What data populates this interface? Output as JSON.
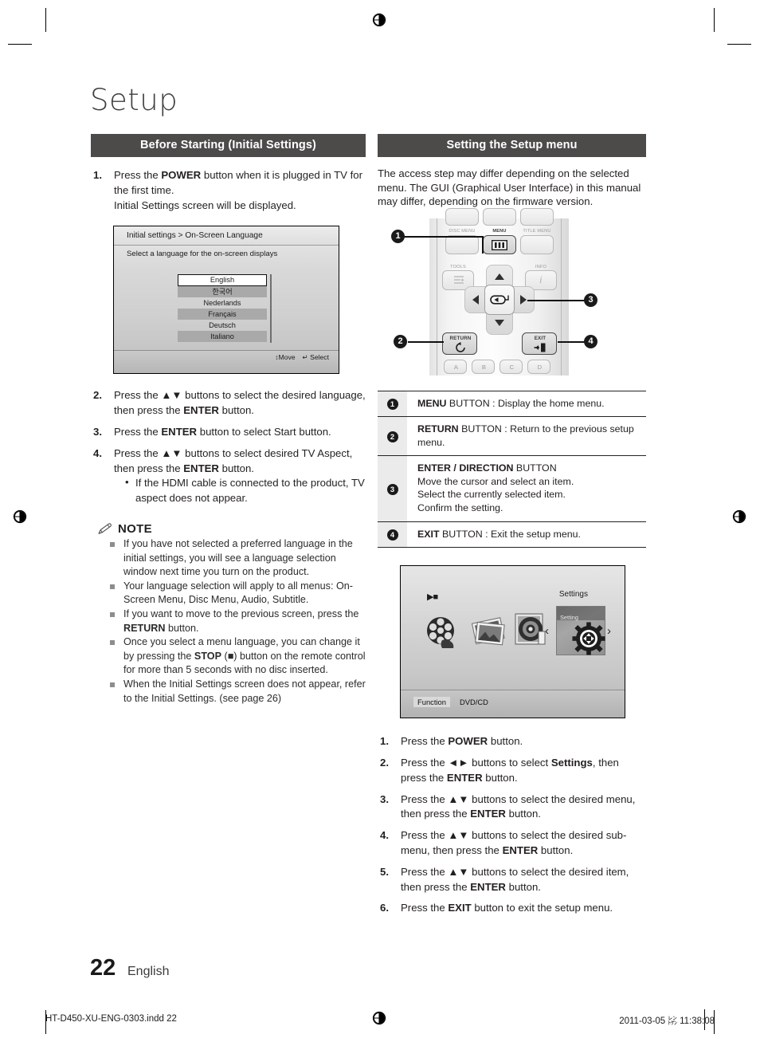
{
  "page": {
    "title": "Setup",
    "number": "22",
    "language": "English",
    "footer_file": "HT-D450-XU-ENG-0303.indd   22",
    "footer_date": "2011-03-05   ㍖ 11:38:08"
  },
  "left_column": {
    "section_title": "Before Starting (Initial Settings)",
    "steps": [
      {
        "num": "1.",
        "parts": [
          {
            "t": "Press the ",
            "b": false
          },
          {
            "t": "POWER",
            "b": true
          },
          {
            "t": " button when it is plugged in TV for the first time.",
            "b": false
          },
          {
            "t": "\nInitial Settings screen will be displayed.",
            "b": false
          }
        ]
      }
    ],
    "initial_settings_screen": {
      "breadcrumb": "Initial settings > On-Screen Language",
      "subtitle": "Select a language for the on-screen displays",
      "languages": [
        "English",
        "한국어",
        "Nederlands",
        "Français",
        "Deutsch",
        "Italiano"
      ],
      "selected_language": "English",
      "hint_move": "Move",
      "hint_select": "Select",
      "hint_move_icon": "up-down-arrow-icon",
      "hint_select_icon": "enter-icon"
    },
    "steps2": [
      {
        "num": "2.",
        "parts": [
          {
            "t": "Press the ",
            "b": false
          },
          {
            "t": "▲▼",
            "b": false,
            "arrows": true
          },
          {
            "t": " buttons to select the desired language, then press the ",
            "b": false
          },
          {
            "t": "ENTER",
            "b": true
          },
          {
            "t": " button.",
            "b": false
          }
        ]
      },
      {
        "num": "3.",
        "parts": [
          {
            "t": "Press the ",
            "b": false
          },
          {
            "t": "ENTER",
            "b": true
          },
          {
            "t": " button to select Start button.",
            "b": false
          }
        ]
      },
      {
        "num": "4.",
        "parts": [
          {
            "t": "Press the ",
            "b": false
          },
          {
            "t": "▲▼",
            "b": false,
            "arrows": true
          },
          {
            "t": " buttons to select desired TV Aspect, then press the ",
            "b": false
          },
          {
            "t": "ENTER",
            "b": true
          },
          {
            "t": " button.",
            "b": false
          }
        ],
        "sub": [
          "If the HDMI cable is connected to the product, TV aspect does not appear."
        ]
      }
    ],
    "note": {
      "heading": "NOTE",
      "icon": "pencil-icon",
      "items": [
        "If you have not selected a preferred language in the initial settings, you will see a language selection window next time you turn on the product.",
        "Your language selection will apply to all menus: On-Screen Menu, Disc Menu, Audio, Subtitle.",
        "If you want to move to the previous screen, press the RETURN button.",
        "Once you select a menu language, you can change it by pressing the STOP (■) button on the remote control for more than 5 seconds with no disc inserted.",
        "When the Initial Settings screen does not appear, refer to the Initial Settings. (see page 26)"
      ],
      "items_bold_tokens": [
        "",
        "",
        "RETURN",
        "STOP",
        ""
      ]
    }
  },
  "right_column": {
    "section_title": "Setting the Setup menu",
    "intro": "The access step may differ depending on the selected menu. The GUI (Graphical User Interface) in this manual may differ, depending on the firmware version.",
    "remote": {
      "callouts": [
        "1",
        "2",
        "3",
        "4"
      ],
      "button_labels": {
        "disc_menu": "DISC MENU",
        "menu": "MENU",
        "title_menu": "TITLE MENU",
        "tools": "TOOLS",
        "info": "INFO",
        "return": "RETURN",
        "exit": "EXIT",
        "color_a": "A",
        "color_b": "B",
        "color_c": "C",
        "color_d": "D"
      }
    },
    "button_table": [
      {
        "num": "1",
        "lines": [
          [
            {
              "t": "MENU",
              "b": true
            },
            {
              "t": " BUTTON : Display the home menu.",
              "b": false
            }
          ]
        ]
      },
      {
        "num": "2",
        "lines": [
          [
            {
              "t": "RETURN",
              "b": true
            },
            {
              "t": " BUTTON : Return to the previous setup menu.",
              "b": false
            }
          ]
        ]
      },
      {
        "num": "3",
        "lines": [
          [
            {
              "t": "ENTER / DIRECTION",
              "b": true
            },
            {
              "t": " BUTTON",
              "b": false
            }
          ],
          [
            {
              "t": "Move the cursor and select an item.",
              "b": false
            }
          ],
          [
            {
              "t": "Select the currently selected item.",
              "b": false
            }
          ],
          [
            {
              "t": "Confirm the setting.",
              "b": false
            }
          ]
        ]
      },
      {
        "num": "4",
        "lines": [
          [
            {
              "t": "EXIT",
              "b": true
            },
            {
              "t": " BUTTON : Exit the setup menu.",
              "b": false
            }
          ]
        ]
      }
    ],
    "home_screen": {
      "play_icon": "play-stop-icon",
      "settings_label": "Settings",
      "tile_caption": "Setting",
      "left_arrow": "‹",
      "right_arrow": "›",
      "function_label": "Function",
      "function_value": "DVD/CD",
      "thumbs": [
        "videos-icon",
        "photos-icon",
        "disc-icon",
        "settings-tile"
      ]
    },
    "steps": [
      {
        "num": "1.",
        "parts": [
          {
            "t": "Press the ",
            "b": false
          },
          {
            "t": "POWER",
            "b": true
          },
          {
            "t": " button.",
            "b": false
          }
        ]
      },
      {
        "num": "2.",
        "parts": [
          {
            "t": "Press the ",
            "b": false
          },
          {
            "t": "◄►",
            "b": false,
            "arrows": true
          },
          {
            "t": " buttons to select ",
            "b": false
          },
          {
            "t": "Settings",
            "b": true
          },
          {
            "t": ", then press the ",
            "b": false
          },
          {
            "t": "ENTER",
            "b": true
          },
          {
            "t": " button.",
            "b": false
          }
        ]
      },
      {
        "num": "3.",
        "parts": [
          {
            "t": "Press the ",
            "b": false
          },
          {
            "t": "▲▼",
            "b": false,
            "arrows": true
          },
          {
            "t": " buttons to select the desired menu, then press the ",
            "b": false
          },
          {
            "t": "ENTER",
            "b": true
          },
          {
            "t": " button.",
            "b": false
          }
        ]
      },
      {
        "num": "4.",
        "parts": [
          {
            "t": "Press the ",
            "b": false
          },
          {
            "t": "▲▼",
            "b": false,
            "arrows": true
          },
          {
            "t": " buttons to select the desired sub-menu, then press the ",
            "b": false
          },
          {
            "t": "ENTER",
            "b": true
          },
          {
            "t": " button.",
            "b": false
          }
        ]
      },
      {
        "num": "5.",
        "parts": [
          {
            "t": "Press the ",
            "b": false
          },
          {
            "t": "▲▼",
            "b": false,
            "arrows": true
          },
          {
            "t": " buttons to select the desired item, then press the ",
            "b": false
          },
          {
            "t": "ENTER",
            "b": true
          },
          {
            "t": " button.",
            "b": false
          }
        ]
      },
      {
        "num": "6.",
        "parts": [
          {
            "t": "Press the ",
            "b": false
          },
          {
            "t": "EXIT",
            "b": true
          },
          {
            "t": " button to exit the setup menu.",
            "b": false
          }
        ]
      }
    ]
  },
  "colors": {
    "section_bar": "#4d4a4a",
    "text": "#231f20",
    "rule": "#232323"
  }
}
